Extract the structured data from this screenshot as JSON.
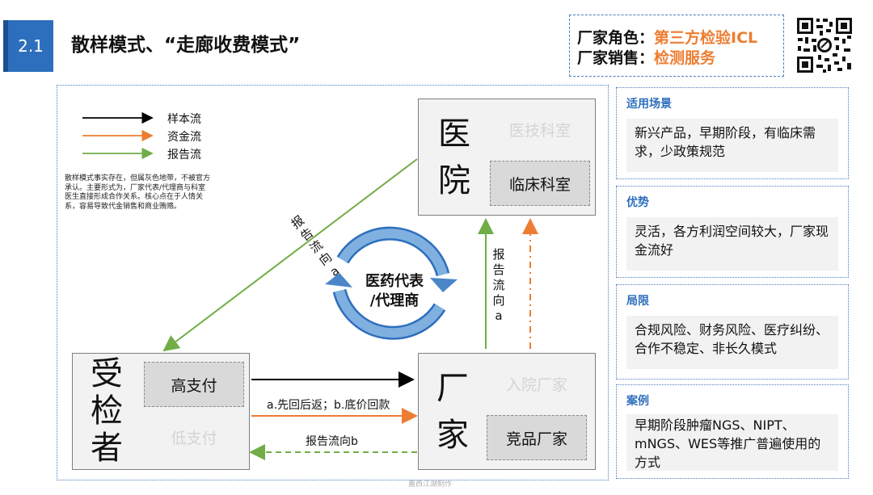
{
  "header": {
    "section_number": "2.1",
    "title": "散样模式、“走廊收费模式”"
  },
  "info": {
    "role_key": "厂家角色：",
    "role_value": "第三方检验ICL",
    "sales_key": "厂家销售：",
    "sales_value": "检测服务"
  },
  "legend": [
    {
      "label": "样本流",
      "color": "#000000"
    },
    {
      "label": "资金流",
      "color": "#ed7d31"
    },
    {
      "label": "报告流",
      "color": "#70ad47"
    }
  ],
  "note": "散样模式事实存在，但属灰色地带，不被官方承认。主要形式为，厂家代表/代理商与科室医生直接形成合作关系。核心点在于人情关系，容易导致代金销售和商业贿赂。",
  "nodes": {
    "hospital": {
      "name_chars": [
        "医",
        "院"
      ],
      "sub_faded": "医技科室",
      "sub_active": "临床科室"
    },
    "patient": {
      "name_chars": [
        "受",
        "检",
        "者"
      ],
      "sub_active": "高支付",
      "sub_faded": "低支付"
    },
    "manufacturer": {
      "name_chars": [
        "厂",
        "家"
      ],
      "sub_faded": "入院厂家",
      "sub_active": "竞品厂家"
    }
  },
  "center_label": [
    "医药代表",
    "/代理商"
  ],
  "flow_labels": {
    "report_a_diag": [
      "报",
      "告",
      "流",
      "向",
      "a"
    ],
    "report_a_vert": [
      "报",
      "告",
      "流",
      "向",
      "a"
    ],
    "money": "a.先回后返；b.底价回款",
    "report_b": "报告流向b"
  },
  "colors": {
    "accent_blue": "#2e6fbd",
    "sample_flow": "#000000",
    "money_flow": "#ed7d31",
    "report_flow": "#70ad47",
    "cycle_arrow": "#5b9bd5"
  },
  "panels": [
    {
      "title": "适用场景",
      "body": "新兴产品，早期阶段，有临床需求，少政策规范"
    },
    {
      "title": "优势",
      "body": "灵活，各方利润空间较大，厂家现金流好"
    },
    {
      "title": "局限",
      "body": "合规风险、财务风险、医疗纠纷、合作不稳定、非长久模式"
    },
    {
      "title": "案例",
      "body": "早期阶段肿瘤NGS、NIPT、mNGS、WES等推广普遍使用的方式"
    }
  ],
  "footer": "嘉西江湖制作"
}
